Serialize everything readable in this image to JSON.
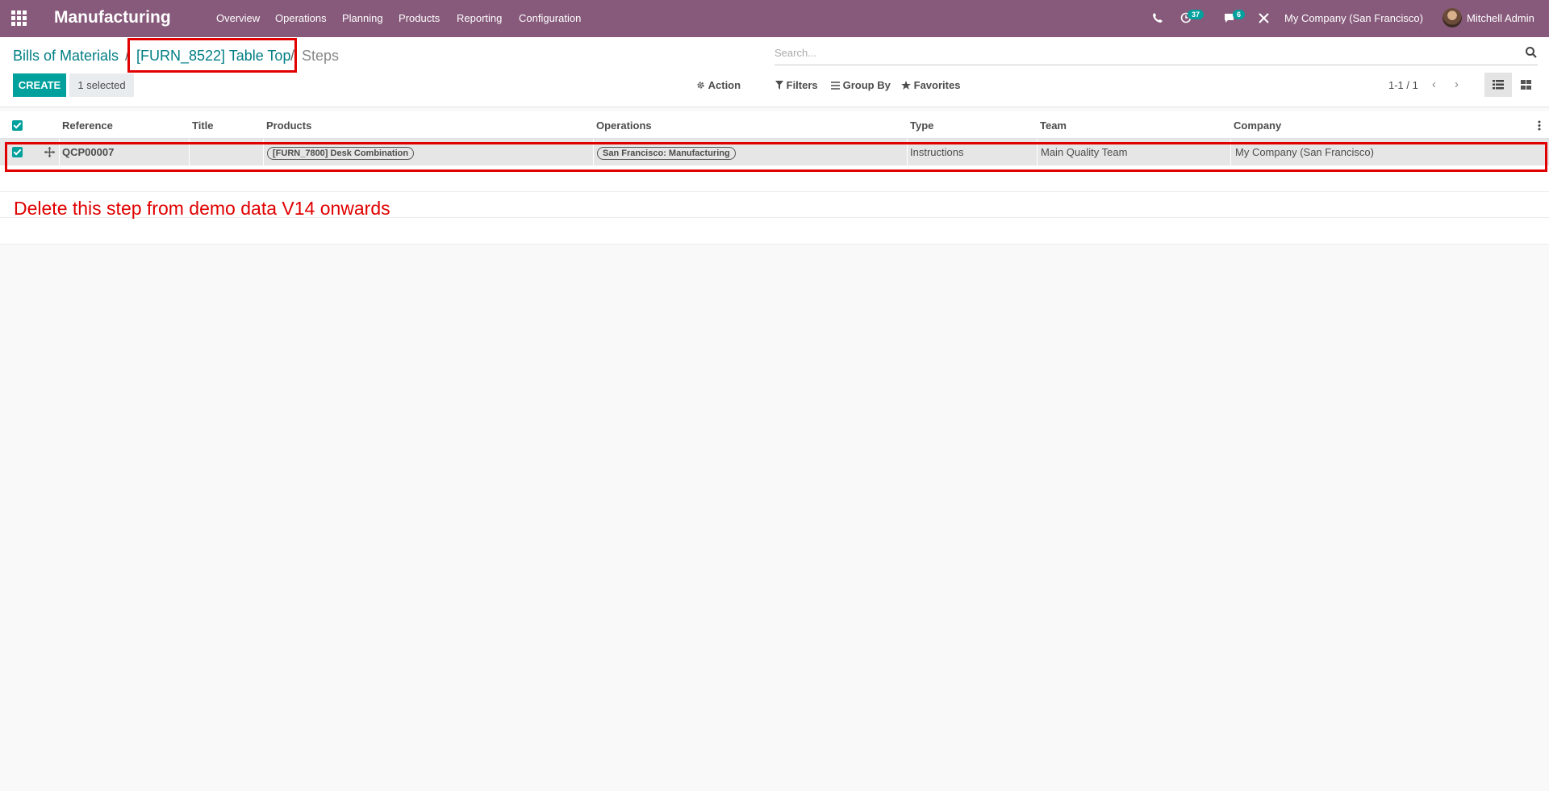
{
  "navbar": {
    "app_name": "Manufacturing",
    "menu": [
      "Overview",
      "Operations",
      "Planning",
      "Products",
      "Reporting",
      "Configuration"
    ],
    "activity_badge": "37",
    "message_badge": "6",
    "company": "My Company (San Francisco)",
    "user": "Mitchell Admin",
    "icons": [
      "apps-grid-icon",
      "phone-icon",
      "clock-icon",
      "chat-icon",
      "close-tools-icon"
    ]
  },
  "breadcrumb": {
    "root": "Bills of Materials",
    "separator": "/",
    "record": "[FURN_8522] Table Top",
    "current": "Steps"
  },
  "search": {
    "placeholder": "Search..."
  },
  "control": {
    "create_label": "CREATE",
    "selected_label": "1 selected",
    "action_label": "Action",
    "filters_label": "Filters",
    "group_by_label": "Group By",
    "favorites_label": "Favorites",
    "pager": "1-1 / 1"
  },
  "table": {
    "headers": [
      "Reference",
      "Title",
      "Products",
      "Operations",
      "Type",
      "Team",
      "Company"
    ],
    "rows": [
      {
        "reference": "QCP00007",
        "title": "",
        "product": "[FURN_7800] Desk Combination",
        "operation": "San Francisco: Manufacturing",
        "type": "Instructions",
        "team": "Main Quality Team",
        "company": "My Company (San Francisco)",
        "selected": true
      }
    ]
  },
  "annotation": {
    "text": "Delete this step from demo data V14 onwards",
    "color": "#e00000"
  },
  "colors": {
    "brand": "#875a7b",
    "accent": "#00a09d",
    "highlight": "#e00000"
  }
}
